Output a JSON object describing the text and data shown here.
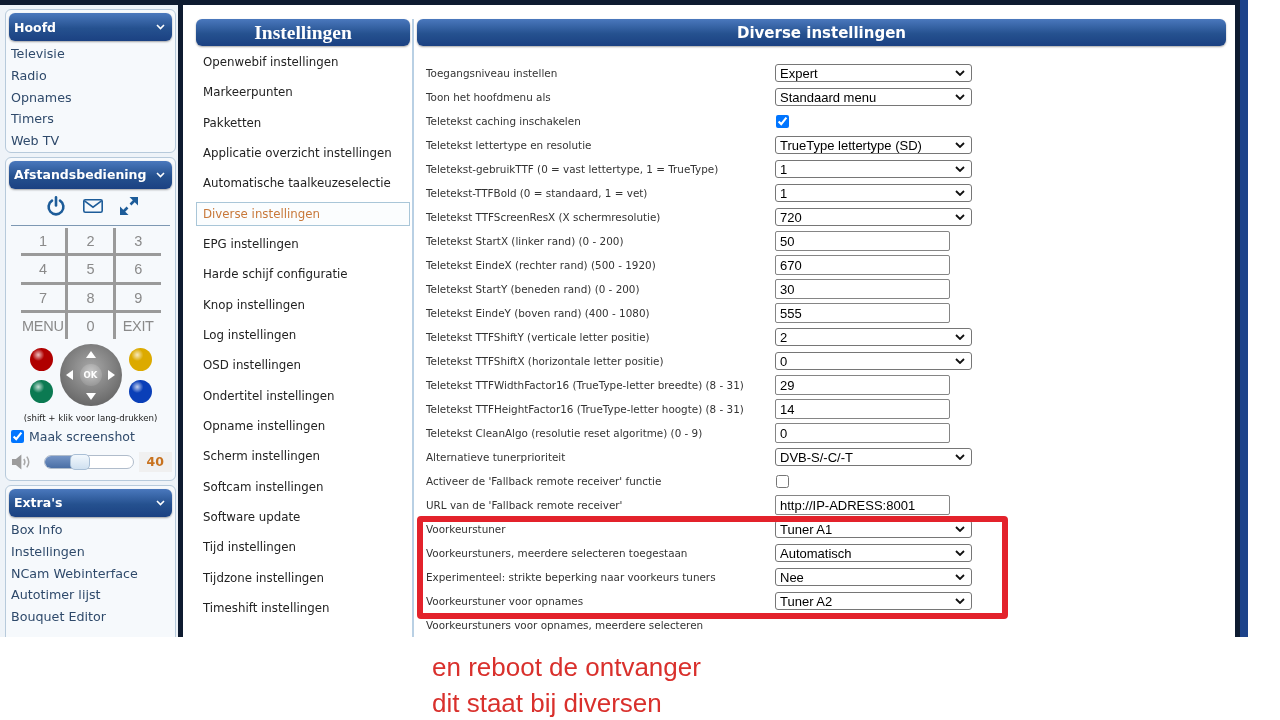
{
  "sidebar": {
    "main_menu": {
      "title": "Hoofd",
      "items": [
        "Televisie",
        "Radio",
        "Opnames",
        "Timers",
        "Web TV"
      ]
    },
    "remote": {
      "title": "Afstandsbediening",
      "keys": [
        "1",
        "2",
        "3",
        "4",
        "5",
        "6",
        "7",
        "8",
        "9",
        "MENU",
        "0",
        "EXIT"
      ],
      "color_keys": [
        {
          "color": "#b00000"
        },
        {
          "color": "#dcaa00"
        },
        {
          "color": "#0b7a52"
        },
        {
          "color": "#0a3fb8"
        }
      ],
      "ok_label": "OK",
      "hint": "(shift + klik voor lang-drukken)",
      "screenshot": {
        "label": "Maak screenshot",
        "checked": true
      },
      "volume": {
        "level": 0.4,
        "reading": "40"
      }
    },
    "extras": {
      "title": "Extra's",
      "items": [
        "Box Info",
        "Instellingen",
        "NCam Webinterface",
        "Autotimer lijst",
        "Bouquet Editor"
      ]
    }
  },
  "settings_menu": {
    "title": "Instellingen",
    "items": [
      {
        "label": "Openwebif instellingen",
        "selected": false
      },
      {
        "label": "Markeerpunten",
        "selected": false
      },
      {
        "label": "Pakketten",
        "selected": false
      },
      {
        "label": "Applicatie overzicht instellingen",
        "selected": false
      },
      {
        "label": "Automatische taalkeuzeselectie",
        "selected": false
      },
      {
        "label": "Diverse instellingen",
        "selected": true
      },
      {
        "label": "EPG instellingen",
        "selected": false
      },
      {
        "label": "Harde schijf configuratie",
        "selected": false
      },
      {
        "label": "Knop instellingen",
        "selected": false
      },
      {
        "label": "Log instellingen",
        "selected": false
      },
      {
        "label": "OSD instellingen",
        "selected": false
      },
      {
        "label": "Ondertitel instellingen",
        "selected": false
      },
      {
        "label": "Opname instellingen",
        "selected": false
      },
      {
        "label": "Scherm instellingen",
        "selected": false
      },
      {
        "label": "Softcam instellingen",
        "selected": false
      },
      {
        "label": "Software update",
        "selected": false
      },
      {
        "label": "Tijd instellingen",
        "selected": false
      },
      {
        "label": "Tijdzone instellingen",
        "selected": false
      },
      {
        "label": "Timeshift instellingen",
        "selected": false
      }
    ]
  },
  "settings": {
    "title": "Diverse instellingen",
    "rows": [
      {
        "label": "Toegangsniveau instellen",
        "kind": "select",
        "value": "Expert",
        "highlighted": false
      },
      {
        "label": "Toon het hoofdmenu als",
        "kind": "select",
        "value": "Standaard menu",
        "highlighted": false
      },
      {
        "label": "Teletekst caching inschakelen",
        "kind": "checkbox",
        "checked": true,
        "highlighted": false
      },
      {
        "label": "Teletekst lettertype en resolutie",
        "kind": "select",
        "value": "TrueType lettertype (SD)",
        "highlighted": false
      },
      {
        "label": "Teletekst-gebruikTTF (0 = vast lettertype, 1 = TrueType)",
        "kind": "select",
        "value": "1",
        "highlighted": false
      },
      {
        "label": "Teletekst-TTFBold (0 = standaard, 1 = vet)",
        "kind": "select",
        "value": "1",
        "highlighted": false
      },
      {
        "label": "Teletekst TTFScreenResX (X schermresolutie)",
        "kind": "select",
        "value": "720",
        "highlighted": false
      },
      {
        "label": "Teletekst StartX (linker rand) (0 - 200)",
        "kind": "input",
        "value": "50",
        "highlighted": false
      },
      {
        "label": "Teletekst EindeX (rechter rand) (500 - 1920)",
        "kind": "input",
        "value": "670",
        "highlighted": false
      },
      {
        "label": "Teletekst StartY (beneden rand) (0 - 200)",
        "kind": "input",
        "value": "30",
        "highlighted": false
      },
      {
        "label": "Teletekst EindeY (boven rand) (400 - 1080)",
        "kind": "input",
        "value": "555",
        "highlighted": false
      },
      {
        "label": "Teletekst TTFShiftY (verticale letter positie)",
        "kind": "select",
        "value": "2",
        "highlighted": false
      },
      {
        "label": "Teletekst TTFShiftX (horizontale letter positie)",
        "kind": "select",
        "value": "0",
        "highlighted": false
      },
      {
        "label": "Teletekst TTFWidthFactor16 (TrueType-letter breedte) (8 - 31)",
        "kind": "input",
        "value": "29",
        "highlighted": false
      },
      {
        "label": "Teletekst TTFHeightFactor16 (TrueType-letter hoogte) (8 - 31)",
        "kind": "input",
        "value": "14",
        "highlighted": false
      },
      {
        "label": "Teletekst CleanAlgo (resolutie reset algoritme) (0 - 9)",
        "kind": "input",
        "value": "0",
        "highlighted": false
      },
      {
        "label": "Alternatieve tunerprioriteit",
        "kind": "select",
        "value": "DVB-S/-C/-T",
        "highlighted": false
      },
      {
        "label": "Activeer de 'Fallback remote receiver' functie",
        "kind": "checkbox",
        "checked": false,
        "highlighted": false
      },
      {
        "label": "URL van de 'Fallback remote receiver'",
        "kind": "input",
        "value": "http://IP-ADRESS:8001",
        "highlighted": false
      },
      {
        "label": "Voorkeurstuner",
        "kind": "select",
        "value": "Tuner A1",
        "highlighted": true
      },
      {
        "label": "Voorkeurstuners, meerdere selecteren toegestaan",
        "kind": "select",
        "value": "Automatisch",
        "highlighted": true
      },
      {
        "label": "Experimenteel: strikte beperking naar voorkeurs tuners",
        "kind": "select",
        "value": "Nee",
        "highlighted": true
      },
      {
        "label": "Voorkeurstuner voor opnames",
        "kind": "select",
        "value": "Tuner A2",
        "highlighted": true
      },
      {
        "label": "Voorkeurstuners voor opnames, meerdere selecteren",
        "highlighted": false
      }
    ]
  },
  "annotation": {
    "lines": [
      "en reboot de ontvanger",
      "dit staat bij diversen"
    ]
  }
}
